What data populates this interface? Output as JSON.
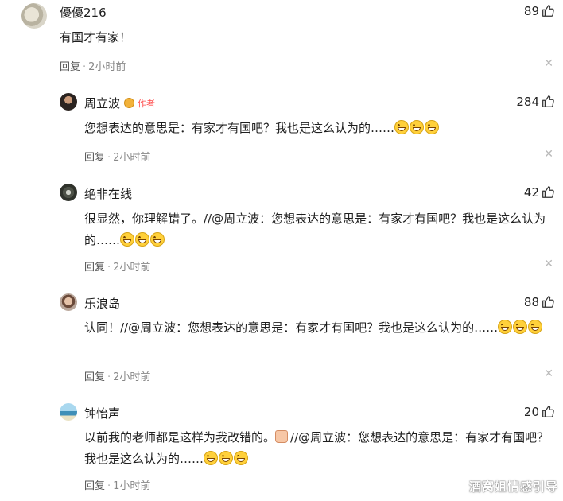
{
  "comments": [
    {
      "user": "優優216",
      "likes": "89",
      "text": "有国才有家！",
      "reply_label": "回复",
      "time": "2小时前"
    },
    {
      "user": "周立波",
      "author_badge": "作者",
      "likes": "284",
      "text": "您想表达的意思是：有家才有国吧？我也是这么认为的……",
      "reply_label": "回复",
      "time": "2小时前"
    },
    {
      "user": "绝非在线",
      "likes": "42",
      "text": "很显然，你理解错了。//@周立波：您想表达的意思是：有家才有国吧？我也是这么认为的……",
      "reply_label": "回复",
      "time": "2小时前"
    },
    {
      "user": "乐浪岛",
      "likes": "88",
      "text": "认同！//@周立波：您想表达的意思是：有家才有国吧？我也是这么认为的……",
      "reply_label": "回复",
      "time": "2小时前"
    },
    {
      "user": "钟怡声",
      "likes": "20",
      "text_before": "以前我的老师都是这样为我改错的。",
      "text_after": "//@周立波：您想表达的意思是：有家才有国吧？我也是这么认为的……",
      "reply_label": "回复",
      "time": "1小时前"
    }
  ],
  "icons": {
    "like": "thumbs-up-icon",
    "close": "close-icon",
    "emoji": "grinning-face-emoji"
  },
  "watermark": "酒窝姐情感引导",
  "colors": {
    "author_badge": "#ff4a4a",
    "text": "#1f1f1f",
    "meta": "#888888"
  }
}
